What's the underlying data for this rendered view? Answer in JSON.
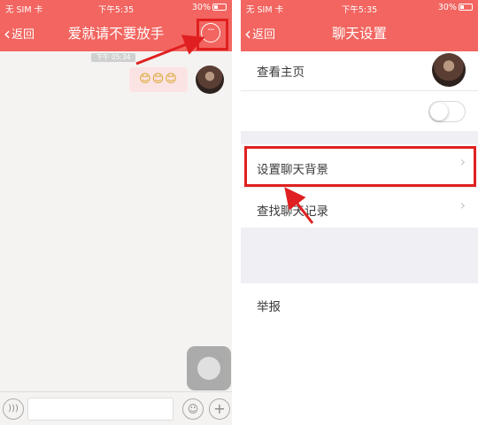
{
  "status_bar": {
    "carrier": "无 SIM 卡",
    "time": "下午5:35",
    "battery": "30%"
  },
  "left_screen": {
    "back_label": "返回",
    "title": "爱就请不要放手",
    "more_icon_text": "···",
    "message_time": "下午 05:34",
    "message_text": "😊😊😊"
  },
  "right_screen": {
    "back_label": "返回",
    "title": "聊天设置",
    "view_homepage_label": "查看主页",
    "set_background_label": "设置聊天背景",
    "find_history_label": "查找聊天记录",
    "report_label": "举报",
    "toggle_state": "off"
  },
  "annotation": {
    "highlight_color": "#e02020"
  }
}
